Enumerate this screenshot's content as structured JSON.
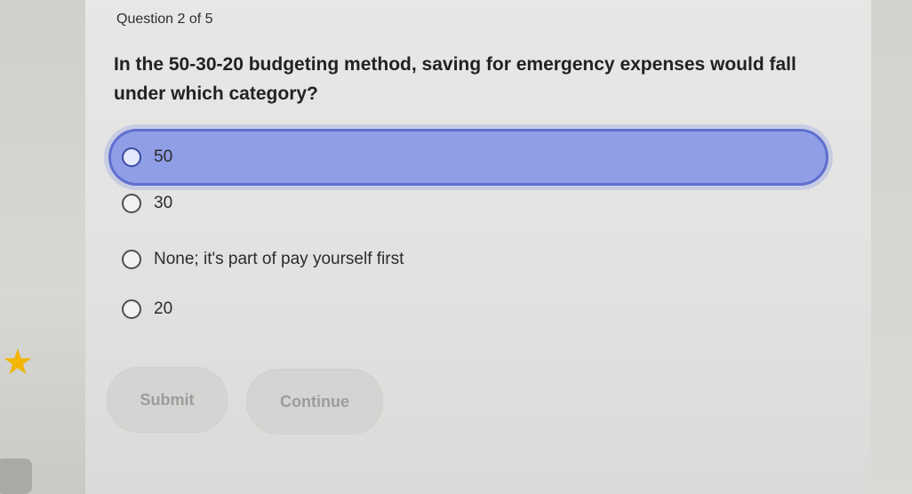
{
  "quiz": {
    "counter": "Question 2 of 5",
    "question": "In the 50-30-20 budgeting method, saving for emergency expenses would fall under which category?",
    "options": [
      {
        "label": "50",
        "selected": true
      },
      {
        "label": "30",
        "selected": false
      },
      {
        "label": "None; it's part of pay yourself first",
        "selected": false
      },
      {
        "label": "20",
        "selected": false
      }
    ],
    "submit_label": "Submit",
    "continue_label": "Continue"
  },
  "colors": {
    "selected_fill": "#8f9ee6",
    "selected_border": "#5f6fcf",
    "disabled_button": "#d4d4d2",
    "star": "#f2b500"
  },
  "icons": [
    "star-icon",
    "radio-icon"
  ]
}
